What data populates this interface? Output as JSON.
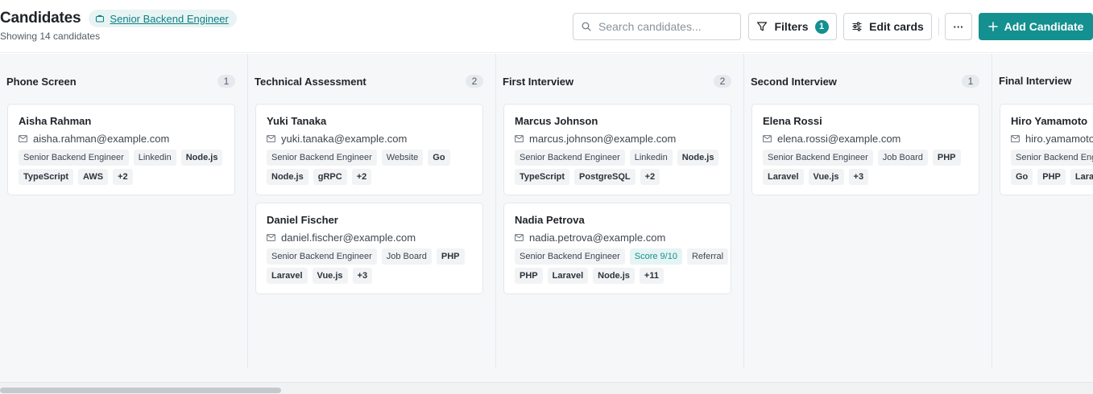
{
  "header": {
    "title": "Candidates",
    "job_label": "Senior Backend Engineer",
    "subtitle": "Showing 14 candidates",
    "search_placeholder": "Search candidates...",
    "filters_label": "Filters",
    "filters_count": "1",
    "edit_cards_label": "Edit cards",
    "more_label": "···",
    "add_label": "Add Candidate",
    "accent_color": "#13908f"
  },
  "columns": [
    {
      "title": "Phone Screen",
      "count": "1",
      "cards": [
        {
          "name": "Aisha Rahman",
          "email": "aisha.rahman@example.com",
          "tags1": [
            {
              "t": "Senior Backend Engineer"
            },
            {
              "t": "Linkedin"
            },
            {
              "t": "Node.js",
              "skill": true
            }
          ],
          "tags2": [
            {
              "t": "TypeScript",
              "skill": true
            },
            {
              "t": "AWS",
              "skill": true
            },
            {
              "t": "+2",
              "skill": true
            }
          ]
        }
      ]
    },
    {
      "title": "Technical Assessment",
      "count": "2",
      "cards": [
        {
          "name": "Yuki Tanaka",
          "email": "yuki.tanaka@example.com",
          "tags1": [
            {
              "t": "Senior Backend Engineer"
            },
            {
              "t": "Website"
            },
            {
              "t": "Go",
              "skill": true
            }
          ],
          "tags2": [
            {
              "t": "Node.js",
              "skill": true
            },
            {
              "t": "gRPC",
              "skill": true
            },
            {
              "t": "+2",
              "skill": true
            }
          ]
        },
        {
          "name": "Daniel Fischer",
          "email": "daniel.fischer@example.com",
          "tags1": [
            {
              "t": "Senior Backend Engineer"
            },
            {
              "t": "Job Board"
            },
            {
              "t": "PHP",
              "skill": true
            }
          ],
          "tags2": [
            {
              "t": "Laravel",
              "skill": true
            },
            {
              "t": "Vue.js",
              "skill": true
            },
            {
              "t": "+3",
              "skill": true
            }
          ]
        }
      ]
    },
    {
      "title": "First Interview",
      "count": "2",
      "cards": [
        {
          "name": "Marcus Johnson",
          "email": "marcus.johnson@example.com",
          "tags1": [
            {
              "t": "Senior Backend Engineer"
            },
            {
              "t": "Linkedin"
            },
            {
              "t": "Node.js",
              "skill": true
            }
          ],
          "tags2": [
            {
              "t": "TypeScript",
              "skill": true
            },
            {
              "t": "PostgreSQL",
              "skill": true
            },
            {
              "t": "+2",
              "skill": true
            }
          ]
        },
        {
          "name": "Nadia Petrova",
          "email": "nadia.petrova@example.com",
          "tags1": [
            {
              "t": "Senior Backend Engineer"
            },
            {
              "t": "Score 9/10",
              "score": true
            },
            {
              "t": "Referral"
            }
          ],
          "tags2": [
            {
              "t": "PHP",
              "skill": true
            },
            {
              "t": "Laravel",
              "skill": true
            },
            {
              "t": "Node.js",
              "skill": true
            },
            {
              "t": "+11",
              "skill": true
            }
          ]
        }
      ]
    },
    {
      "title": "Second Interview",
      "count": "1",
      "cards": [
        {
          "name": "Elena Rossi",
          "email": "elena.rossi@example.com",
          "tags1": [
            {
              "t": "Senior Backend Engineer"
            },
            {
              "t": "Job Board"
            },
            {
              "t": "PHP",
              "skill": true
            }
          ],
          "tags2": [
            {
              "t": "Laravel",
              "skill": true
            },
            {
              "t": "Vue.js",
              "skill": true
            },
            {
              "t": "+3",
              "skill": true
            }
          ]
        }
      ]
    },
    {
      "title": "Final Interview",
      "count": "",
      "cards": [
        {
          "name": "Hiro Yamamoto",
          "email": "hiro.yamamoto",
          "tags1": [
            {
              "t": "Senior Backend Engi"
            }
          ],
          "tags2": [
            {
              "t": "Go",
              "skill": true
            },
            {
              "t": "PHP",
              "skill": true
            },
            {
              "t": "Larav",
              "skill": true
            }
          ]
        }
      ]
    }
  ]
}
